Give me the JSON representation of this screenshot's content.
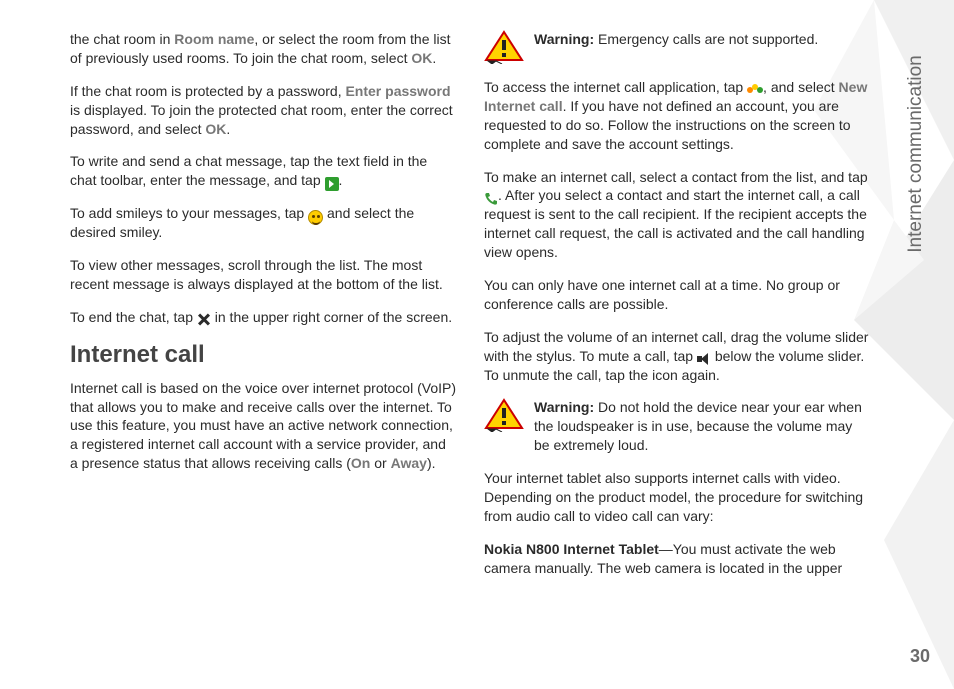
{
  "sideLabel": "Internet communication",
  "pageNumber": "30",
  "left": {
    "p1a": "the chat room in ",
    "p1_room": "Room name",
    "p1b": ", or select the room from the list of previously used rooms. To join the chat room, select ",
    "p1_ok": "OK",
    "p1c": ".",
    "p2a": "If the chat room is protected by a password, ",
    "p2_enter": "Enter password",
    "p2b": " is displayed. To join the protected chat room, enter the correct password, and select ",
    "p2_ok": "OK",
    "p2c": ".",
    "p3a": "To write and send a chat message, tap the text field in the chat toolbar, enter the message, and tap ",
    "p3b": ".",
    "p4a": "To add smileys to your messages, tap ",
    "p4b": " and select the desired smiley.",
    "p5": "To view other messages, scroll through the list. The most recent message is always displayed at the bottom of the list.",
    "p6a": "To end the chat, tap ",
    "p6b": " in the upper right corner of the screen.",
    "h2": "Internet call",
    "p7a": "Internet call is based on the voice over internet protocol (VoIP) that allows you to make and receive calls over the internet. To use this feature, you must have an active network connection, a registered internet call account with a service provider, and a presence status that allows receiving calls (",
    "p7_on": "On",
    "p7_or": " or ",
    "p7_away": "Away",
    "p7b": ")."
  },
  "right": {
    "warn1_label": "Warning:",
    "warn1_text": " Emergency calls are not supported.",
    "p1a": "To access the internet call application, tap ",
    "p1b": ", and select ",
    "p1_new": "New Internet call",
    "p1c": ". If you have not defined an account, you are requested to do so. Follow the instructions on the screen to complete and save the account settings.",
    "p2a": "To make an internet call, select a contact from the list, and tap ",
    "p2b": ". After you select a contact and start the internet call, a call request is sent to the call recipient. If the recipient accepts the internet call request, the call is activated and the call handling view opens.",
    "p3": "You can only have one internet call at a time. No group or conference calls are possible.",
    "p4a": "To adjust the volume of an internet call, drag the volume slider with the stylus. To mute a call, tap ",
    "p4b": " below the volume slider. To unmute the call, tap the icon again.",
    "warn2_label": "Warning:",
    "warn2_text": " Do not hold the device near your ear when the loudspeaker is in use, because the volume may be extremely loud.",
    "p5": "Your internet tablet also supports internet calls with video. Depending on the product model, the procedure for switching from audio call to video call can vary:",
    "p6_device": "Nokia N800 Internet Tablet",
    "p6a": "—You must activate the web camera manually. The web camera is located in the upper"
  }
}
